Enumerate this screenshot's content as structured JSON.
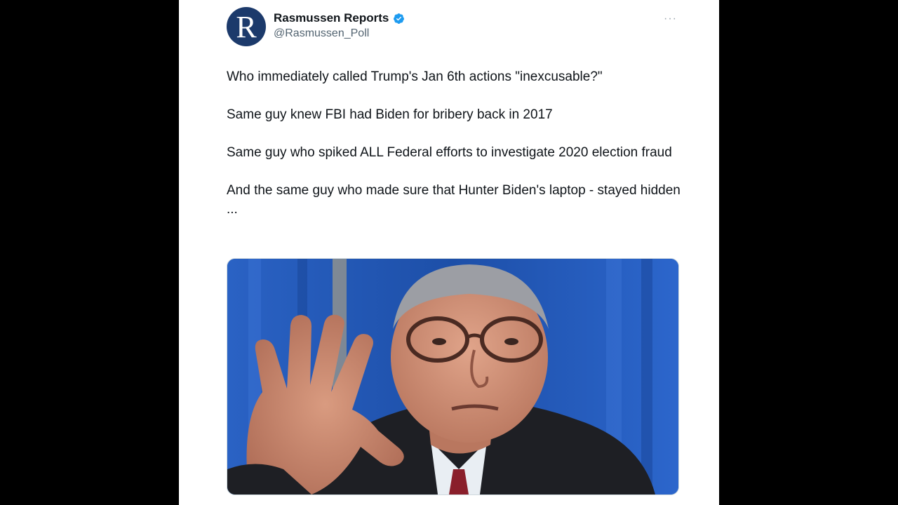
{
  "tweet": {
    "author": {
      "name": "Rasmussen Reports",
      "handle": "@Rasmussen_Poll",
      "avatar_letter": "R",
      "verified_icon": "verified-badge-icon"
    },
    "more_label": "···",
    "lines": [
      "Who immediately called Trump's Jan 6th actions \"inexcusable?\"",
      "Same guy knew FBI had Biden for bribery back in 2017",
      "Same guy who spiked ALL Federal efforts to investigate 2020 election fraud",
      "And the same guy who made sure that Hunter Biden's laptop - stayed hidden ..."
    ]
  },
  "colors": {
    "accent": "#1d9bf0",
    "avatar_bg": "#1c3a6b",
    "text": "#0f1419",
    "handle": "#536471",
    "backdrop": "#000000"
  }
}
